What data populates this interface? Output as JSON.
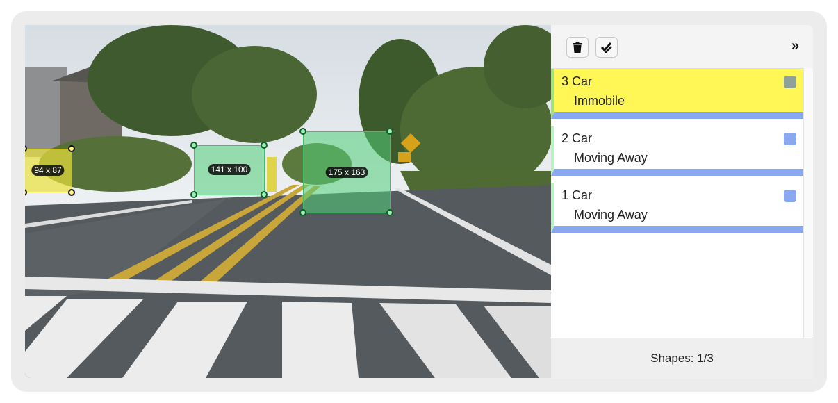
{
  "annotations": [
    {
      "size": "94 x 87",
      "color": "yellow"
    },
    {
      "size": "141 x 100",
      "color": "green"
    },
    {
      "size": "175 x 163",
      "color": "green"
    }
  ],
  "toolbar": {
    "delete_icon": "trash-icon",
    "check_icon": "double-check-icon",
    "collapse_label": "»"
  },
  "shapes": [
    {
      "number": "3",
      "label": "Car",
      "attribute": "Immobile",
      "swatch": "#8da39a",
      "selected": true
    },
    {
      "number": "2",
      "label": "Car",
      "attribute": "Moving Away",
      "swatch": "#8aa8ef",
      "selected": false
    },
    {
      "number": "1",
      "label": "Car",
      "attribute": "Moving Away",
      "swatch": "#8aa8ef",
      "selected": false
    }
  ],
  "footer": {
    "shapes_count": "Shapes: 1/3"
  }
}
